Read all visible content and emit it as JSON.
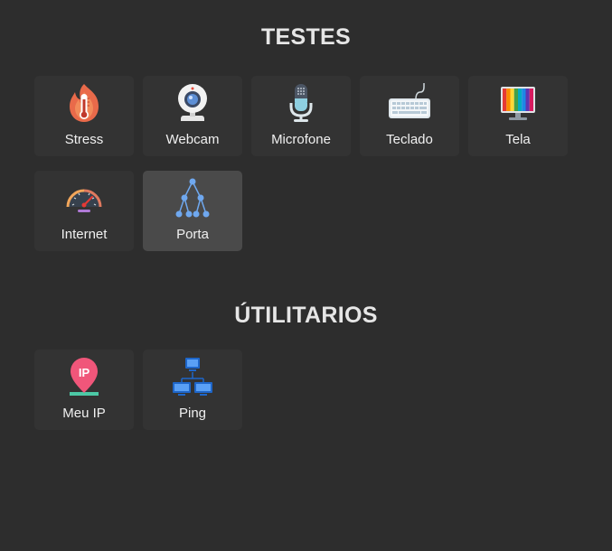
{
  "sections": {
    "testes": {
      "title": "TESTES",
      "tiles": [
        {
          "label": "Stress",
          "icon": "thermometer-fire-icon"
        },
        {
          "label": "Webcam",
          "icon": "webcam-icon"
        },
        {
          "label": "Microfone",
          "icon": "microphone-icon"
        },
        {
          "label": "Teclado",
          "icon": "keyboard-icon"
        },
        {
          "label": "Tela",
          "icon": "monitor-rainbow-icon"
        },
        {
          "label": "Internet",
          "icon": "speedometer-icon"
        },
        {
          "label": "Porta",
          "icon": "network-tree-icon"
        }
      ]
    },
    "utilitarios": {
      "title": "ÚTILITARIOS",
      "tiles": [
        {
          "label": "Meu IP",
          "icon": "ip-pin-icon"
        },
        {
          "label": "Ping",
          "icon": "network-computers-icon"
        }
      ]
    }
  },
  "colors": {
    "background": "#2d2d2d",
    "tile": "#333333",
    "tile_active": "#4a4a4a"
  }
}
